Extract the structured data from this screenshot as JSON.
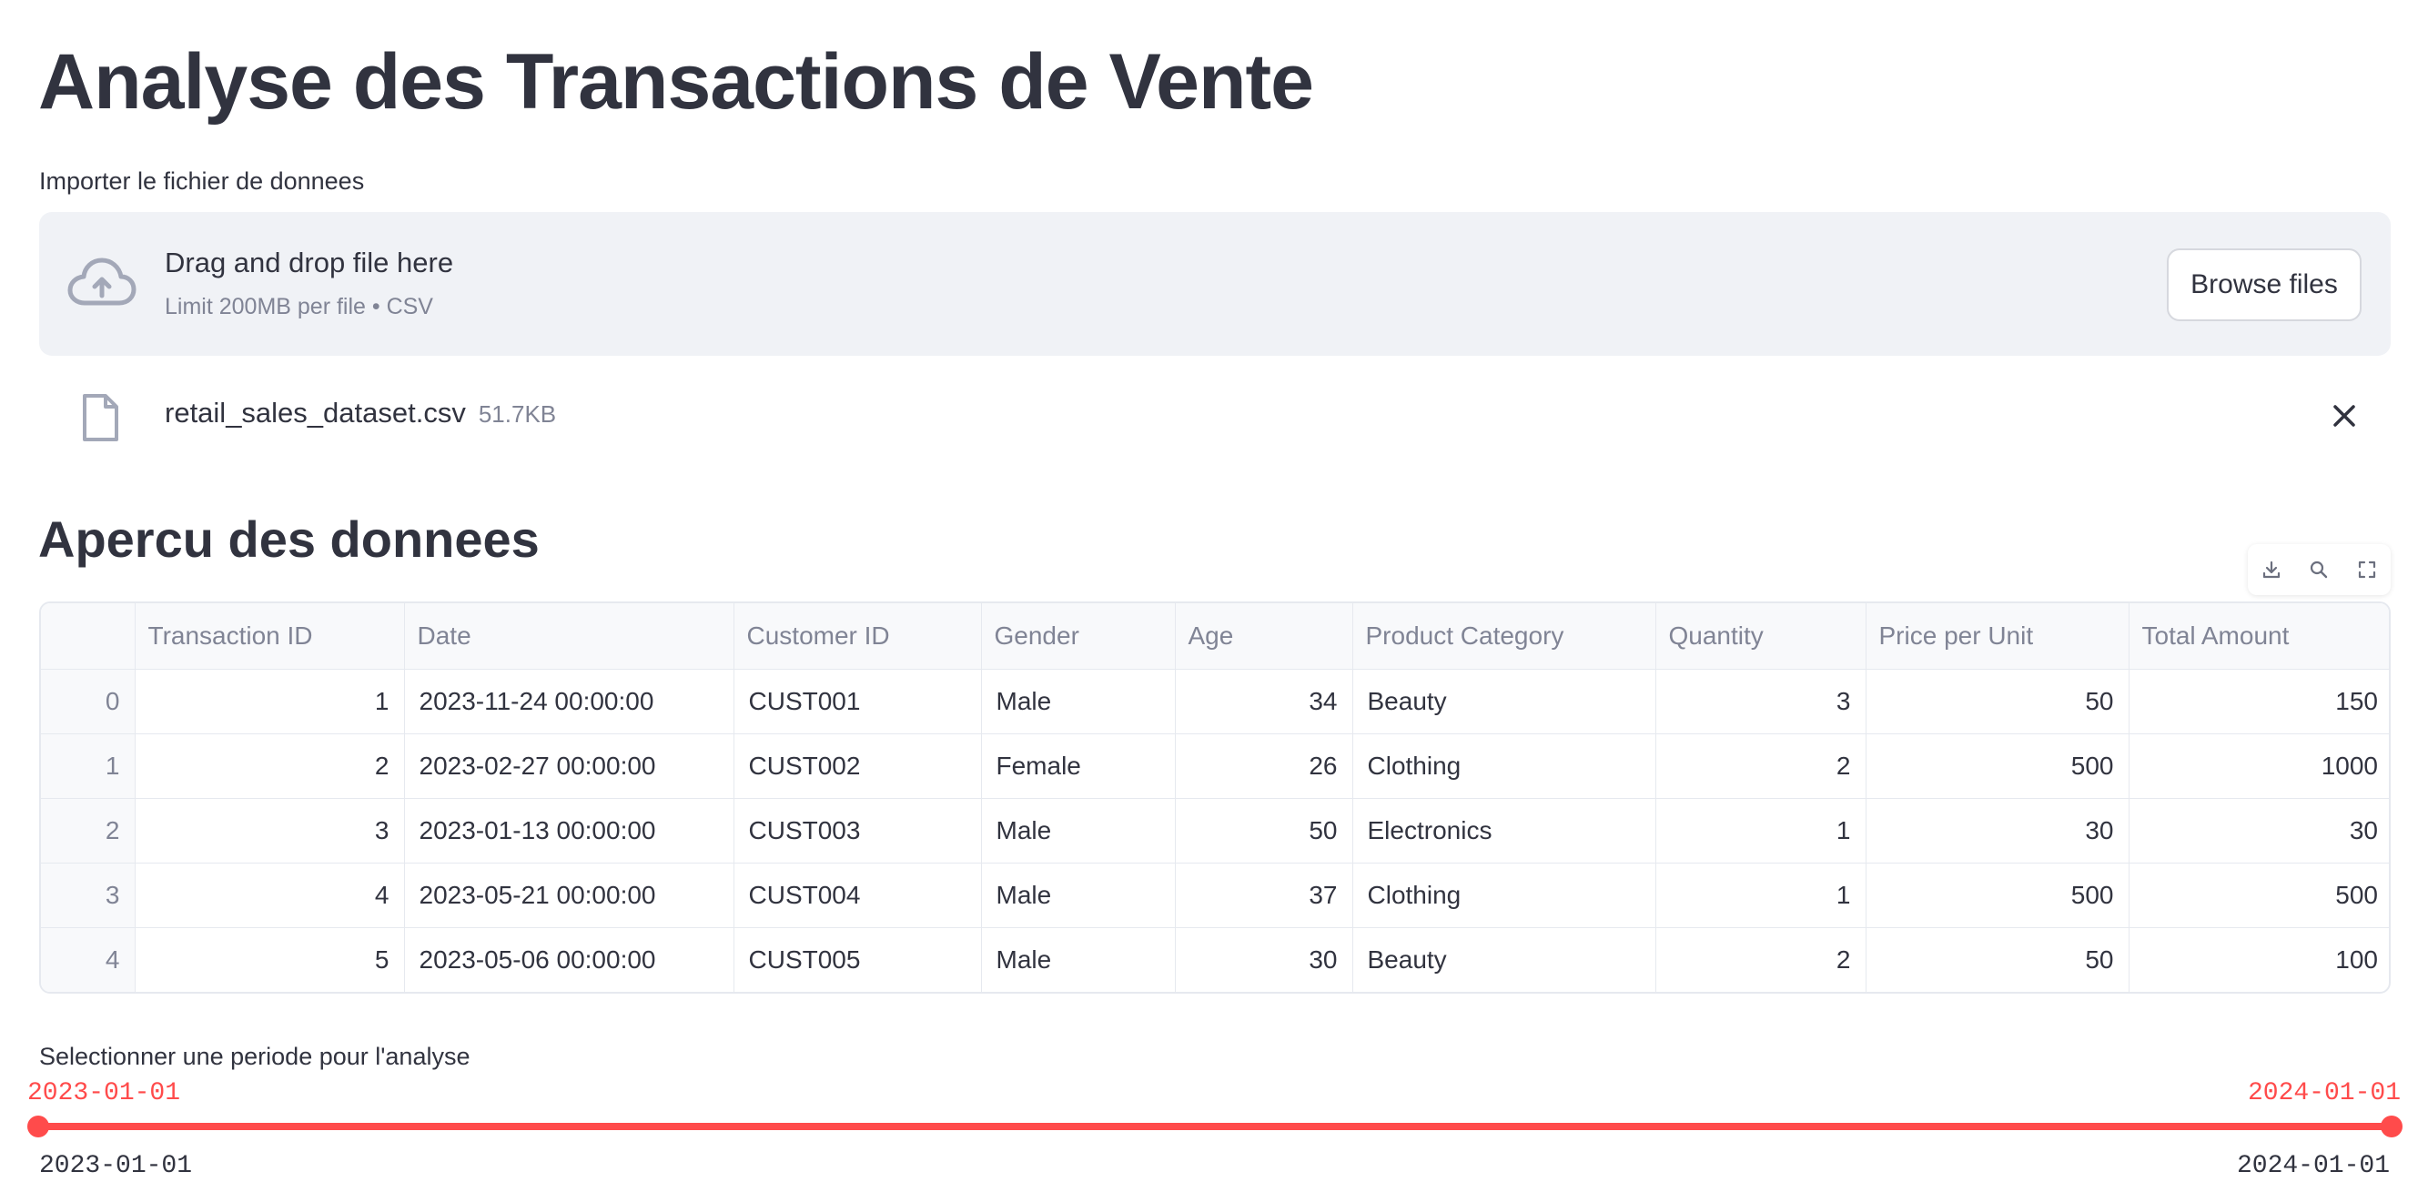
{
  "page": {
    "title": "Analyse des Transactions de Vente"
  },
  "uploader": {
    "label": "Importer le fichier de donnees",
    "drop_text": "Drag and drop file here",
    "limit_text": "Limit 200MB per file • CSV",
    "browse_label": "Browse files",
    "file": {
      "name": "retail_sales_dataset.csv",
      "size": "51.7KB"
    }
  },
  "preview": {
    "title": "Apercu des donnees",
    "columns": [
      "",
      "Transaction ID",
      "Date",
      "Customer ID",
      "Gender",
      "Age",
      "Product Category",
      "Quantity",
      "Price per Unit",
      "Total Amount"
    ],
    "rows": [
      [
        "0",
        "1",
        "2023-11-24 00:00:00",
        "CUST001",
        "Male",
        "34",
        "Beauty",
        "3",
        "50",
        "150"
      ],
      [
        "1",
        "2",
        "2023-02-27 00:00:00",
        "CUST002",
        "Female",
        "26",
        "Clothing",
        "2",
        "500",
        "1000"
      ],
      [
        "2",
        "3",
        "2023-01-13 00:00:00",
        "CUST003",
        "Male",
        "50",
        "Electronics",
        "1",
        "30",
        "30"
      ],
      [
        "3",
        "4",
        "2023-05-21 00:00:00",
        "CUST004",
        "Male",
        "37",
        "Clothing",
        "1",
        "500",
        "500"
      ],
      [
        "4",
        "5",
        "2023-05-06 00:00:00",
        "CUST005",
        "Male",
        "30",
        "Beauty",
        "2",
        "50",
        "100"
      ]
    ]
  },
  "slider": {
    "label": "Selectionner une periode pour l'analyse",
    "value_min": "2023-01-01",
    "value_max": "2024-01-01",
    "range_min": "2023-01-01",
    "range_max": "2024-01-01"
  },
  "colors": {
    "accent": "#ff4b4b",
    "text": "#31333f",
    "muted": "#808495",
    "dropzone_bg": "#f0f2f6"
  },
  "icons": [
    "cloud-upload-icon",
    "file-icon",
    "close-icon",
    "download-icon",
    "search-icon",
    "fullscreen-icon"
  ]
}
